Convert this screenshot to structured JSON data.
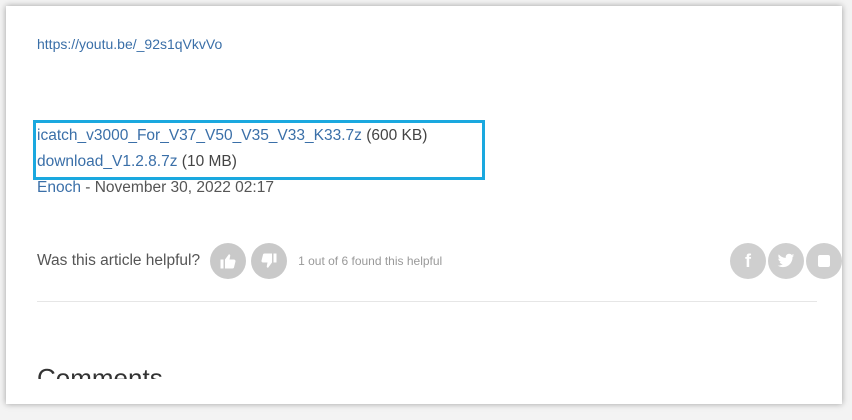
{
  "article": {
    "video_url": "https://youtu.be/_92s1qVkvVo"
  },
  "attachments": [
    {
      "name": "icatch_v3000_For_V37_V50_V35_V33_K33.7z",
      "size": "(600 KB)"
    },
    {
      "name": "download_V1.2.8.7z",
      "size": "(10 MB)"
    }
  ],
  "meta": {
    "author": "Enoch",
    "separator": " - ",
    "date": "November 30, 2022 02:17"
  },
  "feedback": {
    "question": "Was this article helpful?",
    "count_text": "1 out of 6 found this helpful",
    "upvote_icon": "thumbs-up-icon",
    "downvote_icon": "thumbs-down-icon"
  },
  "share": {
    "facebook_glyph": "f",
    "icons": [
      "facebook-icon",
      "twitter-icon",
      "linkedin-icon"
    ]
  },
  "comments": {
    "title": "Comments"
  },
  "colors": {
    "link": "#3a6fa8",
    "highlight_border": "#1aa8df",
    "button_gray": "#c9c9c9"
  }
}
